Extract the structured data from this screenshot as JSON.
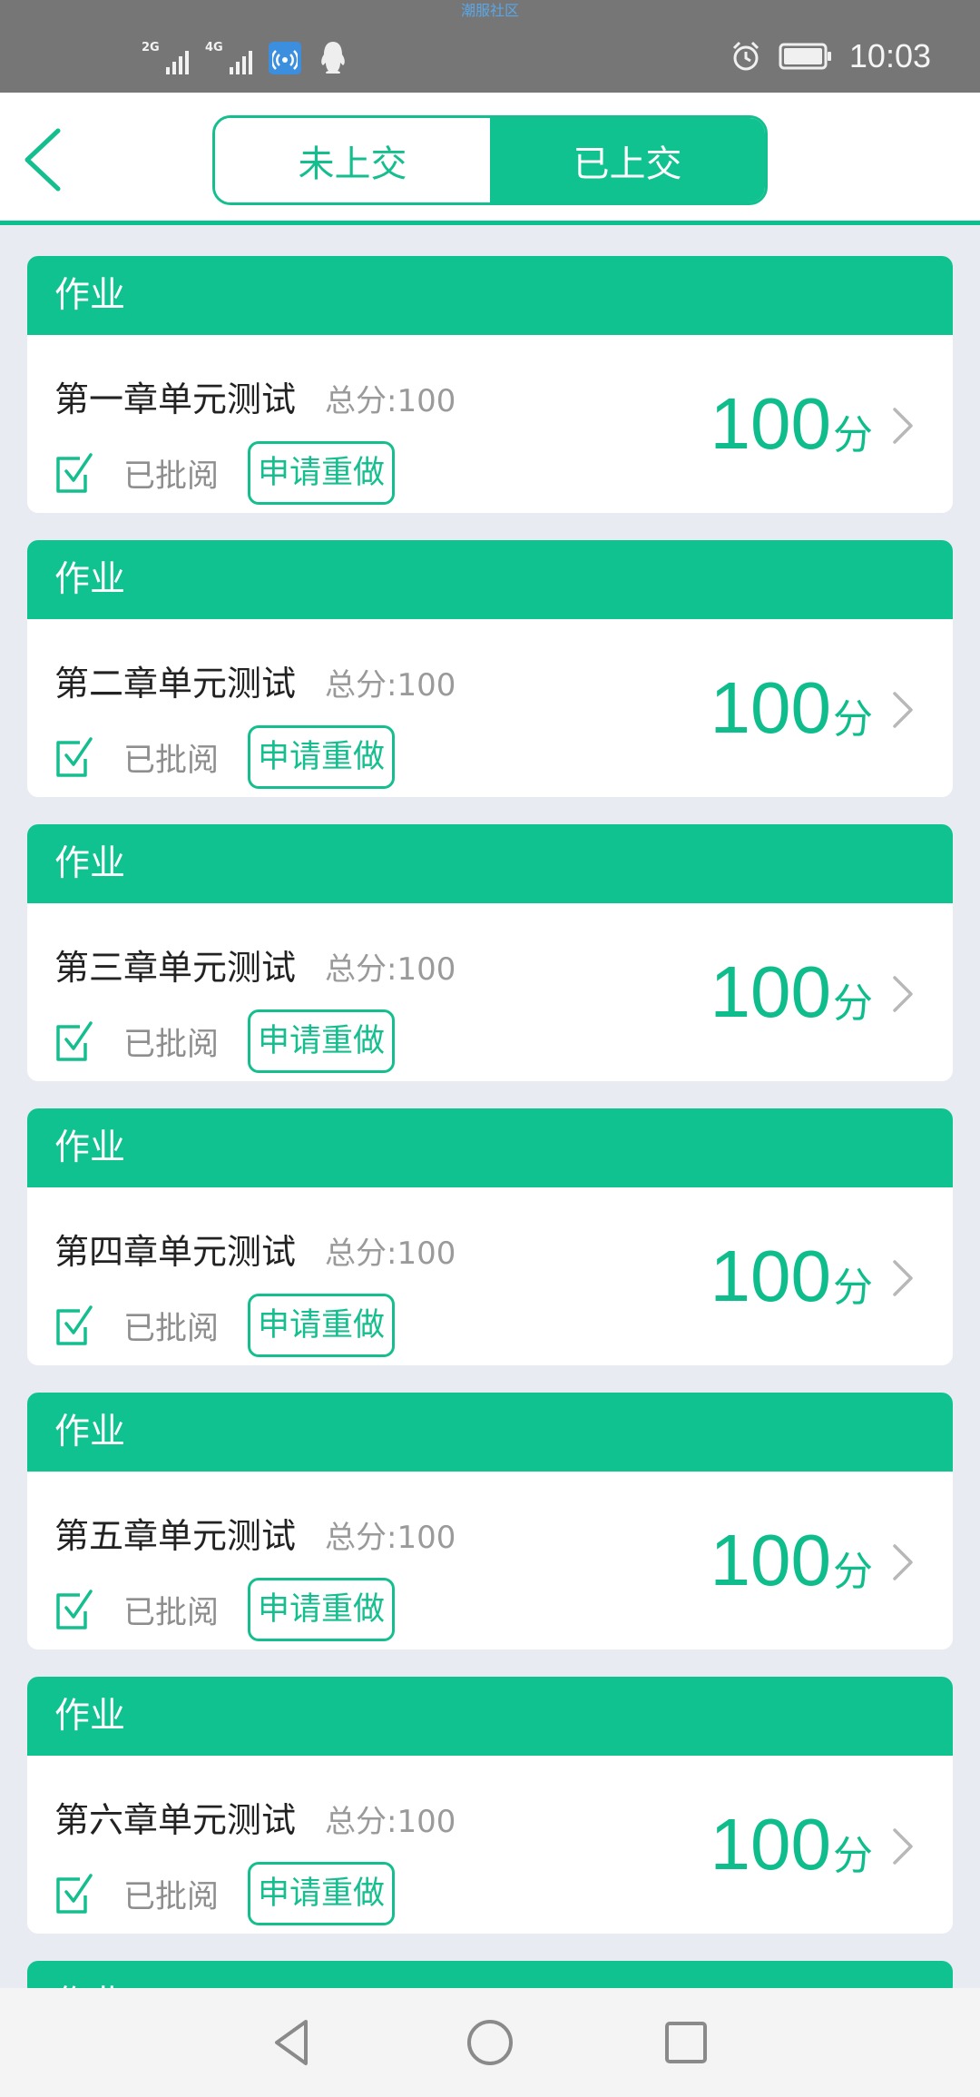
{
  "status_bar": {
    "watermark": "潮服社区",
    "sim1_tag": "2G",
    "sim2_tag": "4G",
    "time": "10:03"
  },
  "header": {
    "tabs": [
      {
        "label": "未上交",
        "active": false
      },
      {
        "label": "已上交",
        "active": true
      }
    ]
  },
  "colors": {
    "accent": "#0fc290",
    "score": "#0fbd8c",
    "background": "#e8ebf1"
  },
  "assignments": [
    {
      "category": "作业",
      "title": "第一章单元测试",
      "total": "总分:100",
      "status": "已批阅",
      "redo_label": "申请重做",
      "score": "100",
      "unit": "分"
    },
    {
      "category": "作业",
      "title": "第二章单元测试",
      "total": "总分:100",
      "status": "已批阅",
      "redo_label": "申请重做",
      "score": "100",
      "unit": "分"
    },
    {
      "category": "作业",
      "title": "第三章单元测试",
      "total": "总分:100",
      "status": "已批阅",
      "redo_label": "申请重做",
      "score": "100",
      "unit": "分"
    },
    {
      "category": "作业",
      "title": "第四章单元测试",
      "total": "总分:100",
      "status": "已批阅",
      "redo_label": "申请重做",
      "score": "100",
      "unit": "分"
    },
    {
      "category": "作业",
      "title": "第五章单元测试",
      "total": "总分:100",
      "status": "已批阅",
      "redo_label": "申请重做",
      "score": "100",
      "unit": "分"
    },
    {
      "category": "作业",
      "title": "第六章单元测试",
      "total": "总分:100",
      "status": "已批阅",
      "redo_label": "申请重做",
      "score": "100",
      "unit": "分"
    }
  ],
  "partial_card": {
    "category": "作业"
  }
}
